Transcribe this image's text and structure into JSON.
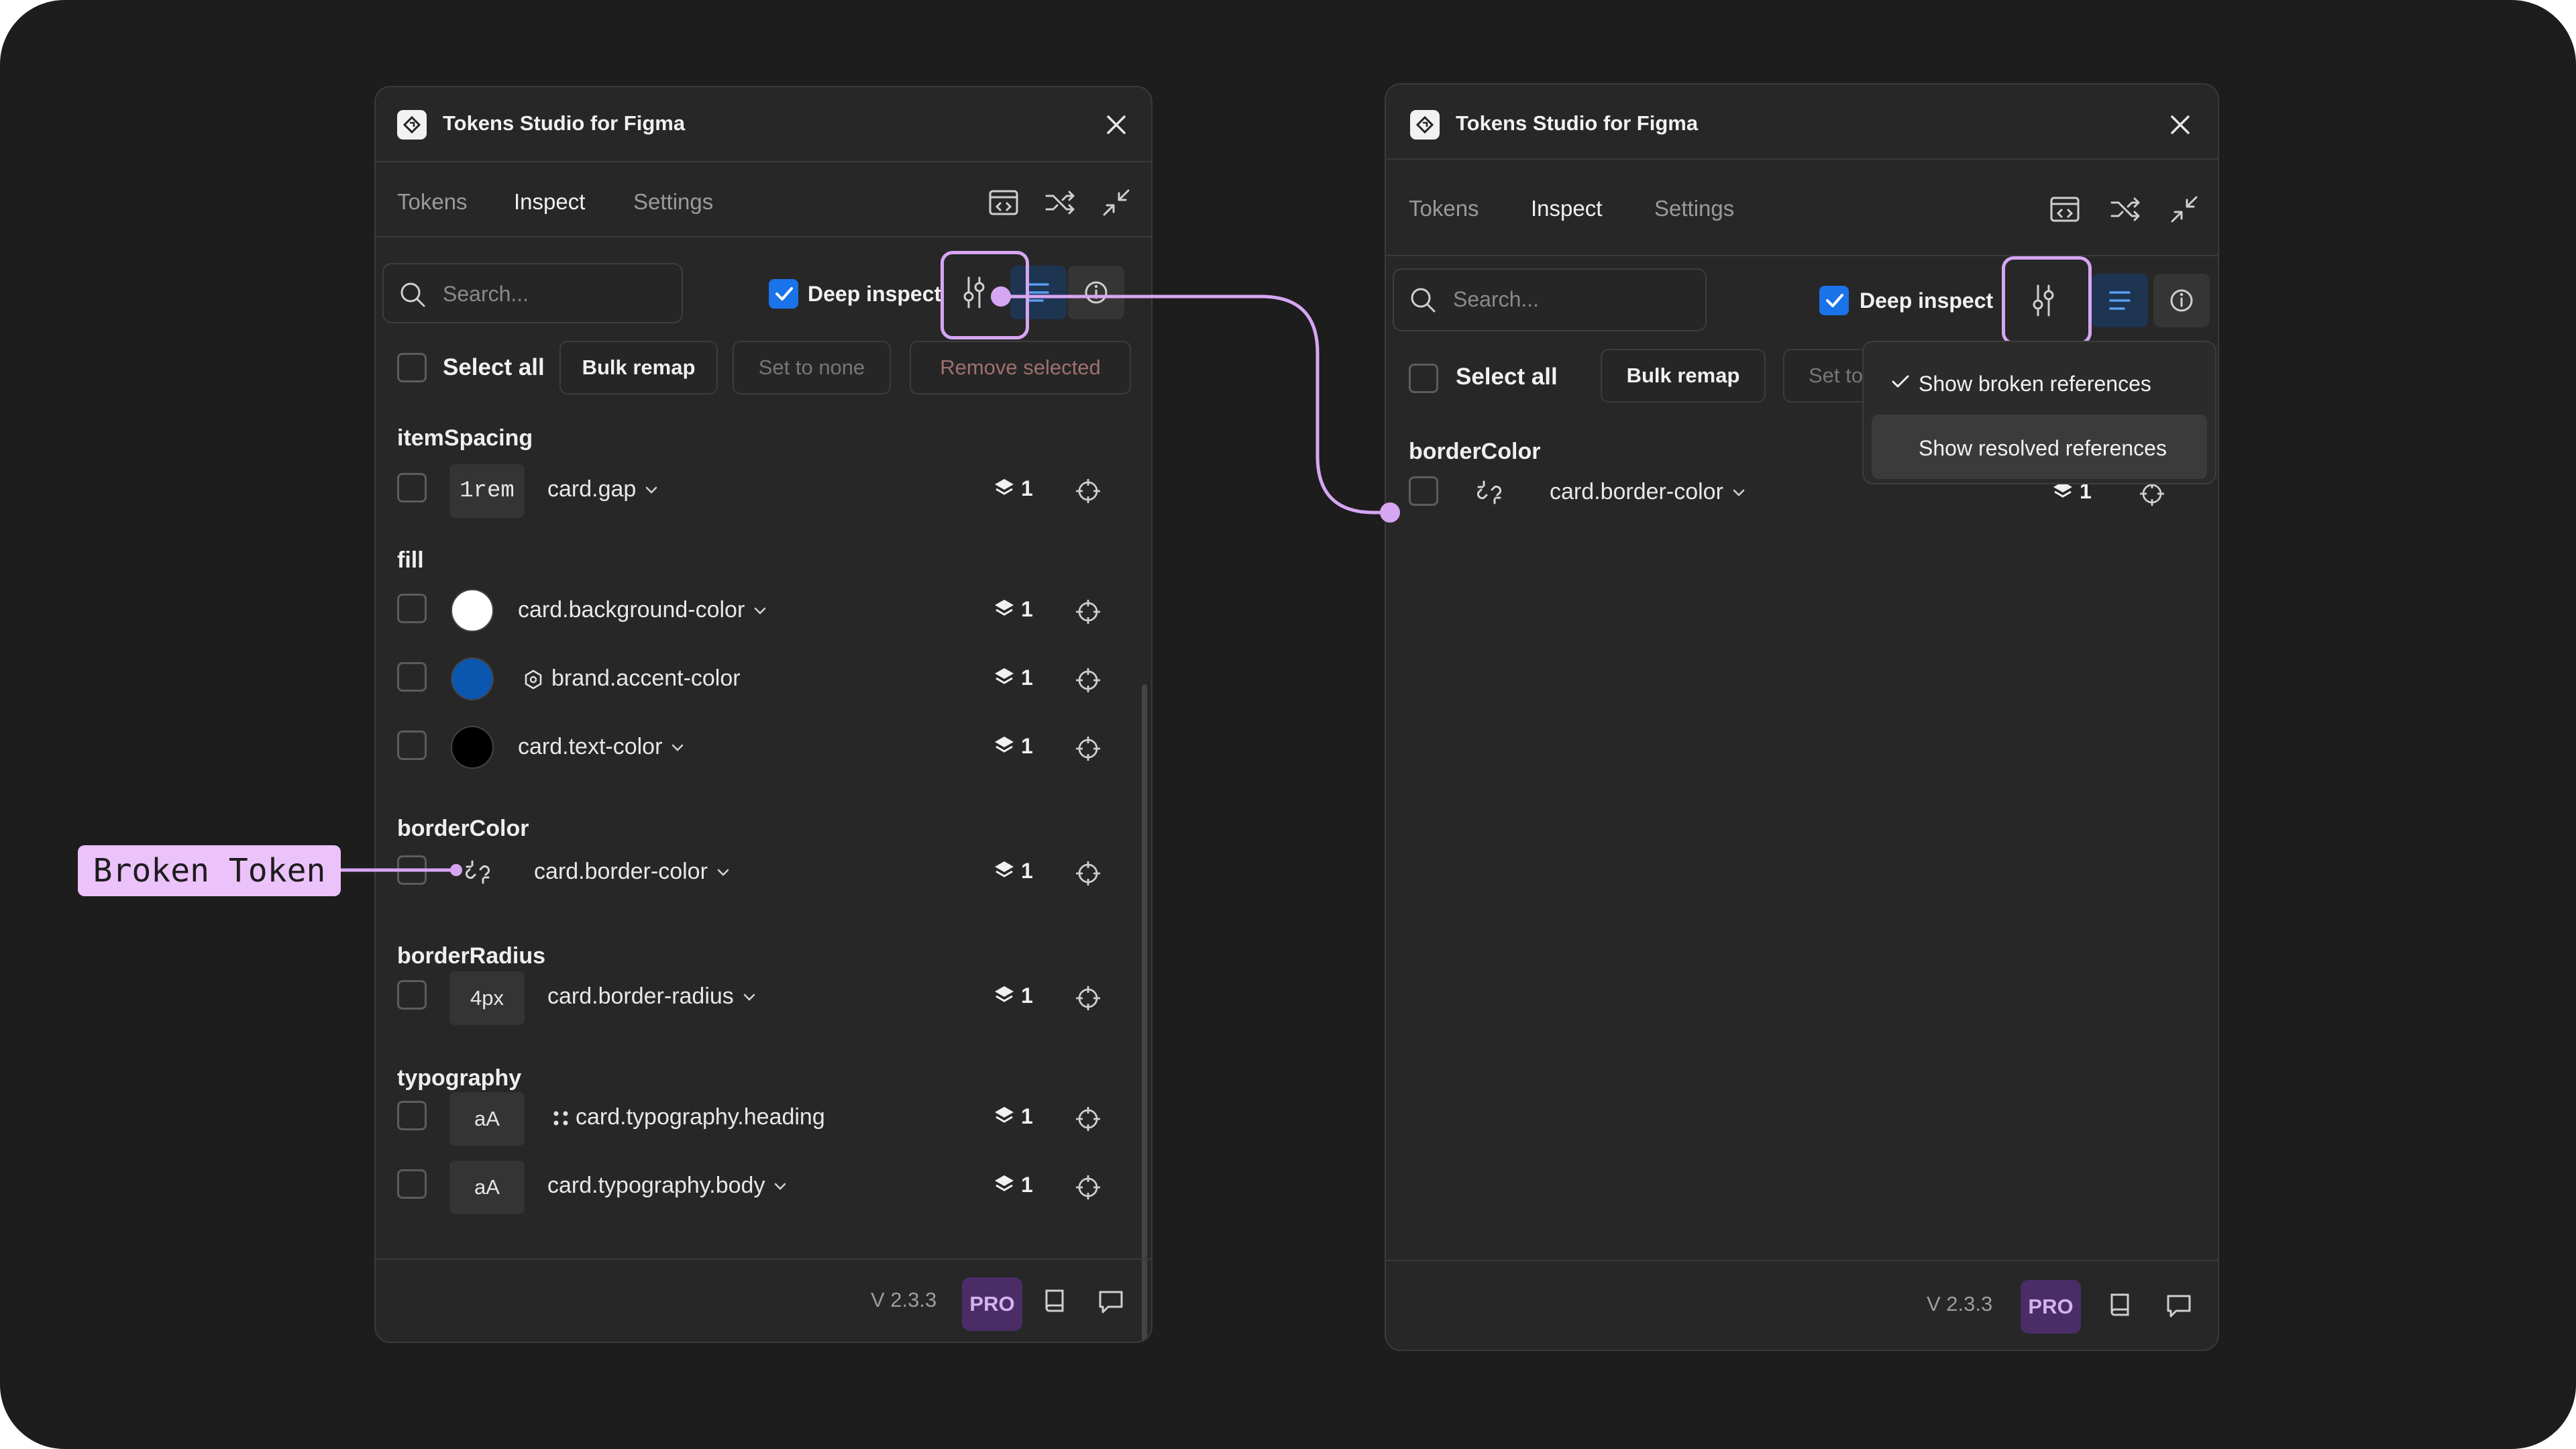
{
  "app": {
    "title": "Tokens Studio for Figma"
  },
  "tabs": [
    "Tokens",
    "Inspect",
    "Settings"
  ],
  "active_tab": "Inspect",
  "search": {
    "placeholder": "Search..."
  },
  "deep_inspect": {
    "label": "Deep inspect",
    "checked": true
  },
  "toolbar": {
    "select_all": "Select all",
    "bulk_remap": "Bulk remap",
    "set_to_none": "Set to none",
    "set_to_none_truncated": "Set to",
    "remove_selected": "Remove selected"
  },
  "panel_left": {
    "groups": [
      {
        "name": "itemSpacing",
        "tokens": [
          {
            "value": "1rem",
            "name": "card.gap",
            "layers": "1"
          }
        ]
      },
      {
        "name": "fill",
        "tokens": [
          {
            "swatch": "#ffffff",
            "name": "card.background-color",
            "layers": "1"
          },
          {
            "swatch": "#0b57b0",
            "name": "brand.accent-color",
            "layers": "1"
          },
          {
            "swatch": "#000000",
            "name": "card.text-color",
            "layers": "1"
          }
        ]
      },
      {
        "name": "borderColor",
        "tokens": [
          {
            "name": "card.border-color",
            "layers": "1",
            "broken": true
          }
        ]
      },
      {
        "name": "borderRadius",
        "tokens": [
          {
            "value": "4px",
            "name": "card.border-radius",
            "layers": "1"
          }
        ]
      },
      {
        "name": "typography",
        "tokens": [
          {
            "value": "aA",
            "name": "card.typography.heading",
            "layers": "1"
          },
          {
            "value": "aA",
            "name": "card.typography.body",
            "layers": "1"
          }
        ]
      }
    ]
  },
  "panel_right": {
    "groups": [
      {
        "name": "borderColor",
        "tokens": [
          {
            "name": "card.border-color",
            "layers": "1",
            "broken": true
          }
        ]
      }
    ],
    "dropdown": [
      {
        "label": "Show broken references",
        "checked": true
      },
      {
        "label": "Show resolved references",
        "checked": false
      }
    ]
  },
  "footer": {
    "version": "V 2.3.3",
    "pro": "PRO"
  },
  "callout": {
    "label": "Broken Token"
  },
  "colors": {
    "accent": "#1a73e8",
    "highlight": "#d6a6f2",
    "pro_bg": "#4a2d66",
    "callout_bg": "#ecc2fb"
  }
}
